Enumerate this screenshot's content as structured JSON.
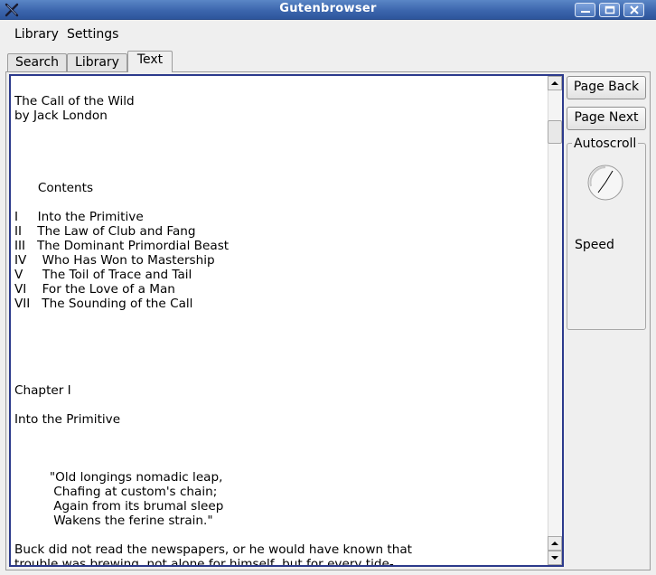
{
  "window": {
    "title": "Gutenbrowser",
    "app_icon": "x-logo-icon",
    "controls": [
      "minimize-icon",
      "maximize-icon",
      "close-icon"
    ]
  },
  "menu": {
    "library": "Library",
    "settings": "Settings"
  },
  "tabs": {
    "search": "Search",
    "library": "Library",
    "text": "Text",
    "active": "Text"
  },
  "text_view": {
    "content": "The Call of the Wild\nby Jack London\n\n\n\n\n      Contents\n\nI     Into the Primitive\nII    The Law of Club and Fang\nIII   The Dominant Primordial Beast\nIV    Who Has Won to Mastership\nV     The Toil of Trace and Tail\nVI    For the Love of a Man\nVII   The Sounding of the Call\n\n\n\n\n\nChapter I\n\nInto the Primitive\n\n\n\n         \"Old longings nomadic leap,\n          Chafing at custom's chain;\n          Again from its brumal sleep\n          Wakens the ferine strain.\"\n\nBuck did not read the newspapers, or he would have known that\ntrouble was brewing, not alone for himself, but for every tide-\nwater dog, strong of muscle and with warm, long hair, from Puget\nSound to San Diego. Because men, groping in the Arctic darkness,"
  },
  "controls": {
    "page_back": "Page Back",
    "page_next": "Page Next",
    "autoscroll_title": "Autoscroll",
    "speed_label": "Speed"
  },
  "colors": {
    "titlebar": "#3c66ad",
    "text_border": "#2c3a8c",
    "background": "#efefef"
  }
}
